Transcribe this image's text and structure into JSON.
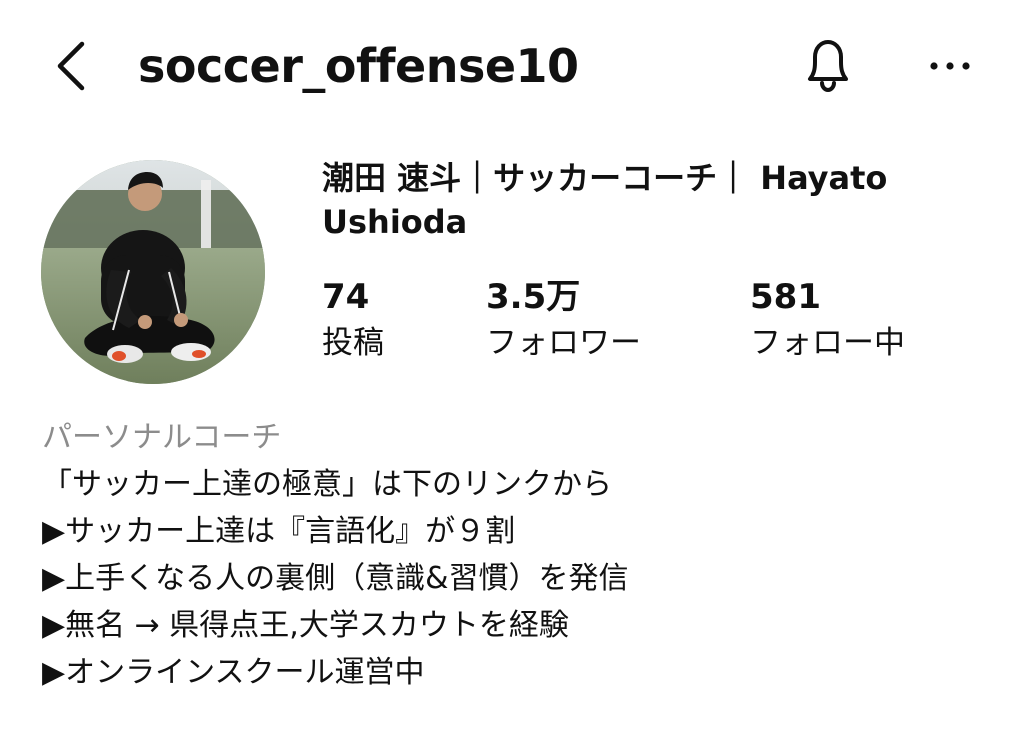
{
  "header": {
    "username": "soccer_offense10",
    "back_icon": "chevron-left-icon",
    "bell_icon": "bell-icon",
    "more_icon": "more-horizontal-icon"
  },
  "profile": {
    "display_name": "潮田 速斗｜サッカーコーチ｜ Hayato Ushioda",
    "stats": [
      {
        "value": "74",
        "label": "投稿"
      },
      {
        "value": "3.5万",
        "label": "フォロワー"
      },
      {
        "value": "581",
        "label": "フォロー中"
      }
    ]
  },
  "bio": {
    "category": "パーソナルコーチ",
    "lines": [
      "「サッカー上達の極意」は下のリンクから",
      "▶サッカー上達は『言語化』が９割",
      "▶上手くなる人の裏側（意識&習慣）を発信",
      "▶無名 → 県得点王,大学スカウトを経験",
      "▶オンラインスクール運営中"
    ]
  },
  "colors": {
    "text": "#111111",
    "category": "#8c8c8c",
    "background": "#ffffff"
  }
}
